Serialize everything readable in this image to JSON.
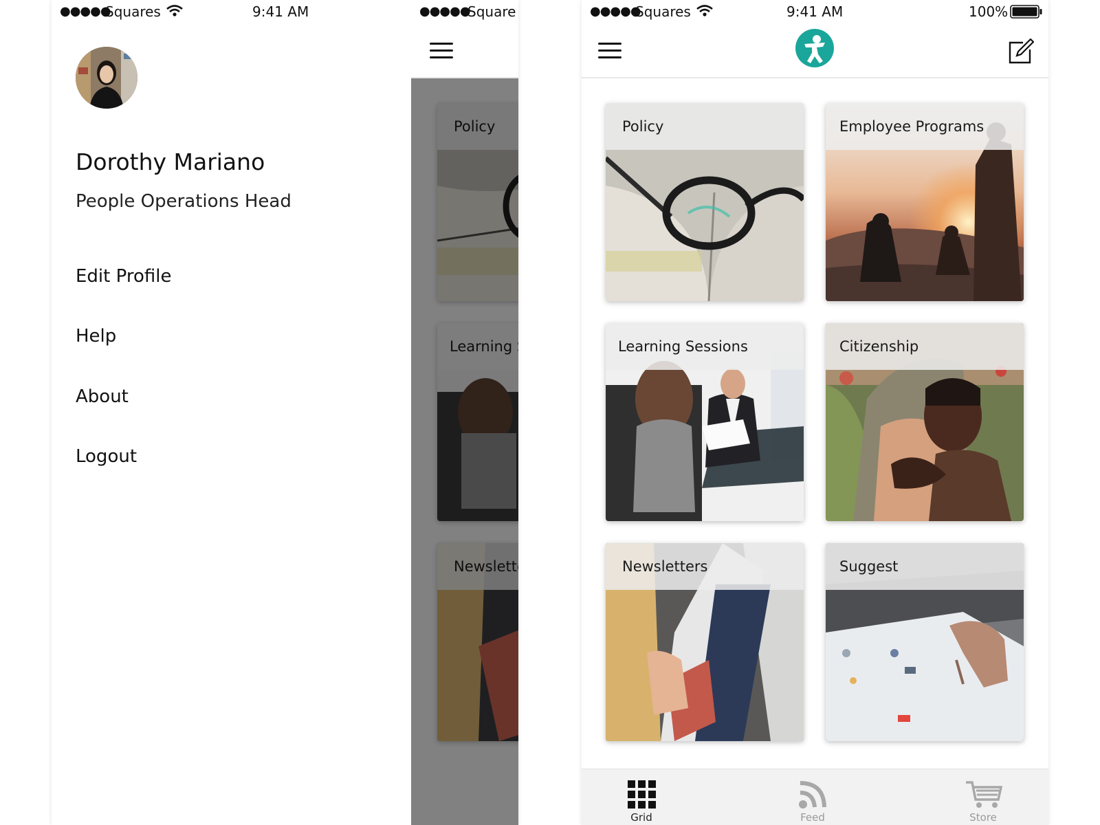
{
  "left_phone": {
    "status": {
      "carrier": "Squares",
      "time": "9:41 AM"
    },
    "drawer": {
      "user_name": "Dorothy Mariano",
      "user_role": "People Operations Head",
      "menu": [
        {
          "label": "Edit Profile"
        },
        {
          "label": "Help"
        },
        {
          "label": "About"
        },
        {
          "label": "Logout"
        }
      ]
    },
    "background_view": {
      "status": {
        "carrier": "Square"
      },
      "tiles": [
        "Policy",
        "Learning S",
        "Newslette"
      ]
    }
  },
  "right_phone": {
    "status": {
      "carrier": "Squares",
      "time": "9:41 AM",
      "battery": "100%"
    },
    "header": {
      "logo_icon": "person-logo-icon",
      "compose_icon": "compose-icon"
    },
    "tiles": [
      {
        "label": "Policy"
      },
      {
        "label": "Employee Programs"
      },
      {
        "label": "Learning Sessions"
      },
      {
        "label": "Citizenship"
      },
      {
        "label": "Newsletters"
      },
      {
        "label": "Suggest"
      }
    ],
    "tabbar": {
      "items": [
        {
          "label": "Grid",
          "icon": "grid-icon",
          "active": true
        },
        {
          "label": "Feed",
          "icon": "rss-feed-icon",
          "active": false
        },
        {
          "label": "Store",
          "icon": "cart-icon",
          "active": false
        }
      ]
    }
  },
  "colors": {
    "accent": "#1aa69a",
    "overlay": "#7a7a7a",
    "tab_inactive": "#9a9a9a"
  }
}
